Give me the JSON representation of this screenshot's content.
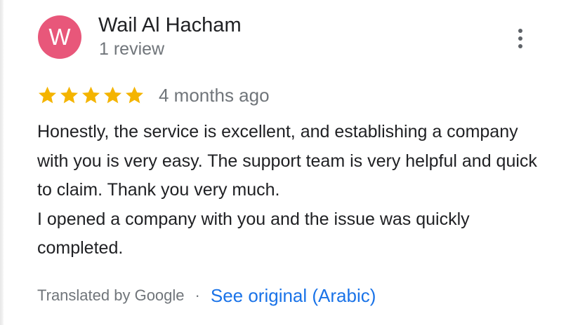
{
  "reviewer": {
    "avatar_initial": "W",
    "avatar_color": "#e8577a",
    "name": "Wail Al Hacham",
    "review_count": "1 review"
  },
  "menu": {
    "icon": "more-vert-icon"
  },
  "review": {
    "rating": 5,
    "rating_max": 5,
    "star_color": "#f4b400",
    "time": "4 months ago",
    "paragraphs": [
      "Honestly, the service is excellent, and establishing a company with you is very easy. The support team is very helpful and quick to claim. Thank you very much.",
      "I opened a company with you and the issue was quickly completed."
    ]
  },
  "translation": {
    "translated_by": "Translated by Google",
    "separator": "·",
    "see_original": "See original (Arabic)",
    "link_color": "#1a73e8"
  }
}
